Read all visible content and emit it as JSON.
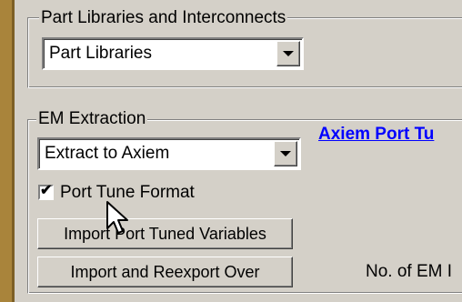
{
  "part_libraries_group": {
    "legend": "Part Libraries and Interconnects",
    "dropdown_value": "Part Libraries"
  },
  "em_extraction_group": {
    "legend": "EM Extraction",
    "dropdown_value": "Extract to Axiem",
    "checkbox_label": "Port Tune Format",
    "checkbox_checked": true,
    "import_button_label": "Import Port Tuned Variables",
    "reexport_button_label": "Import and Reexport Over"
  },
  "axiem_link_text": "Axiem Port Tu",
  "em_count_label": "No. of EM I",
  "icons": [
    "chevron-down-icon",
    "checkmark-icon",
    "mouse-cursor-icon"
  ],
  "colors": {
    "panel_bg": "#d4d0c8",
    "side_bar": "#a9843b",
    "link": "#0000ff"
  }
}
